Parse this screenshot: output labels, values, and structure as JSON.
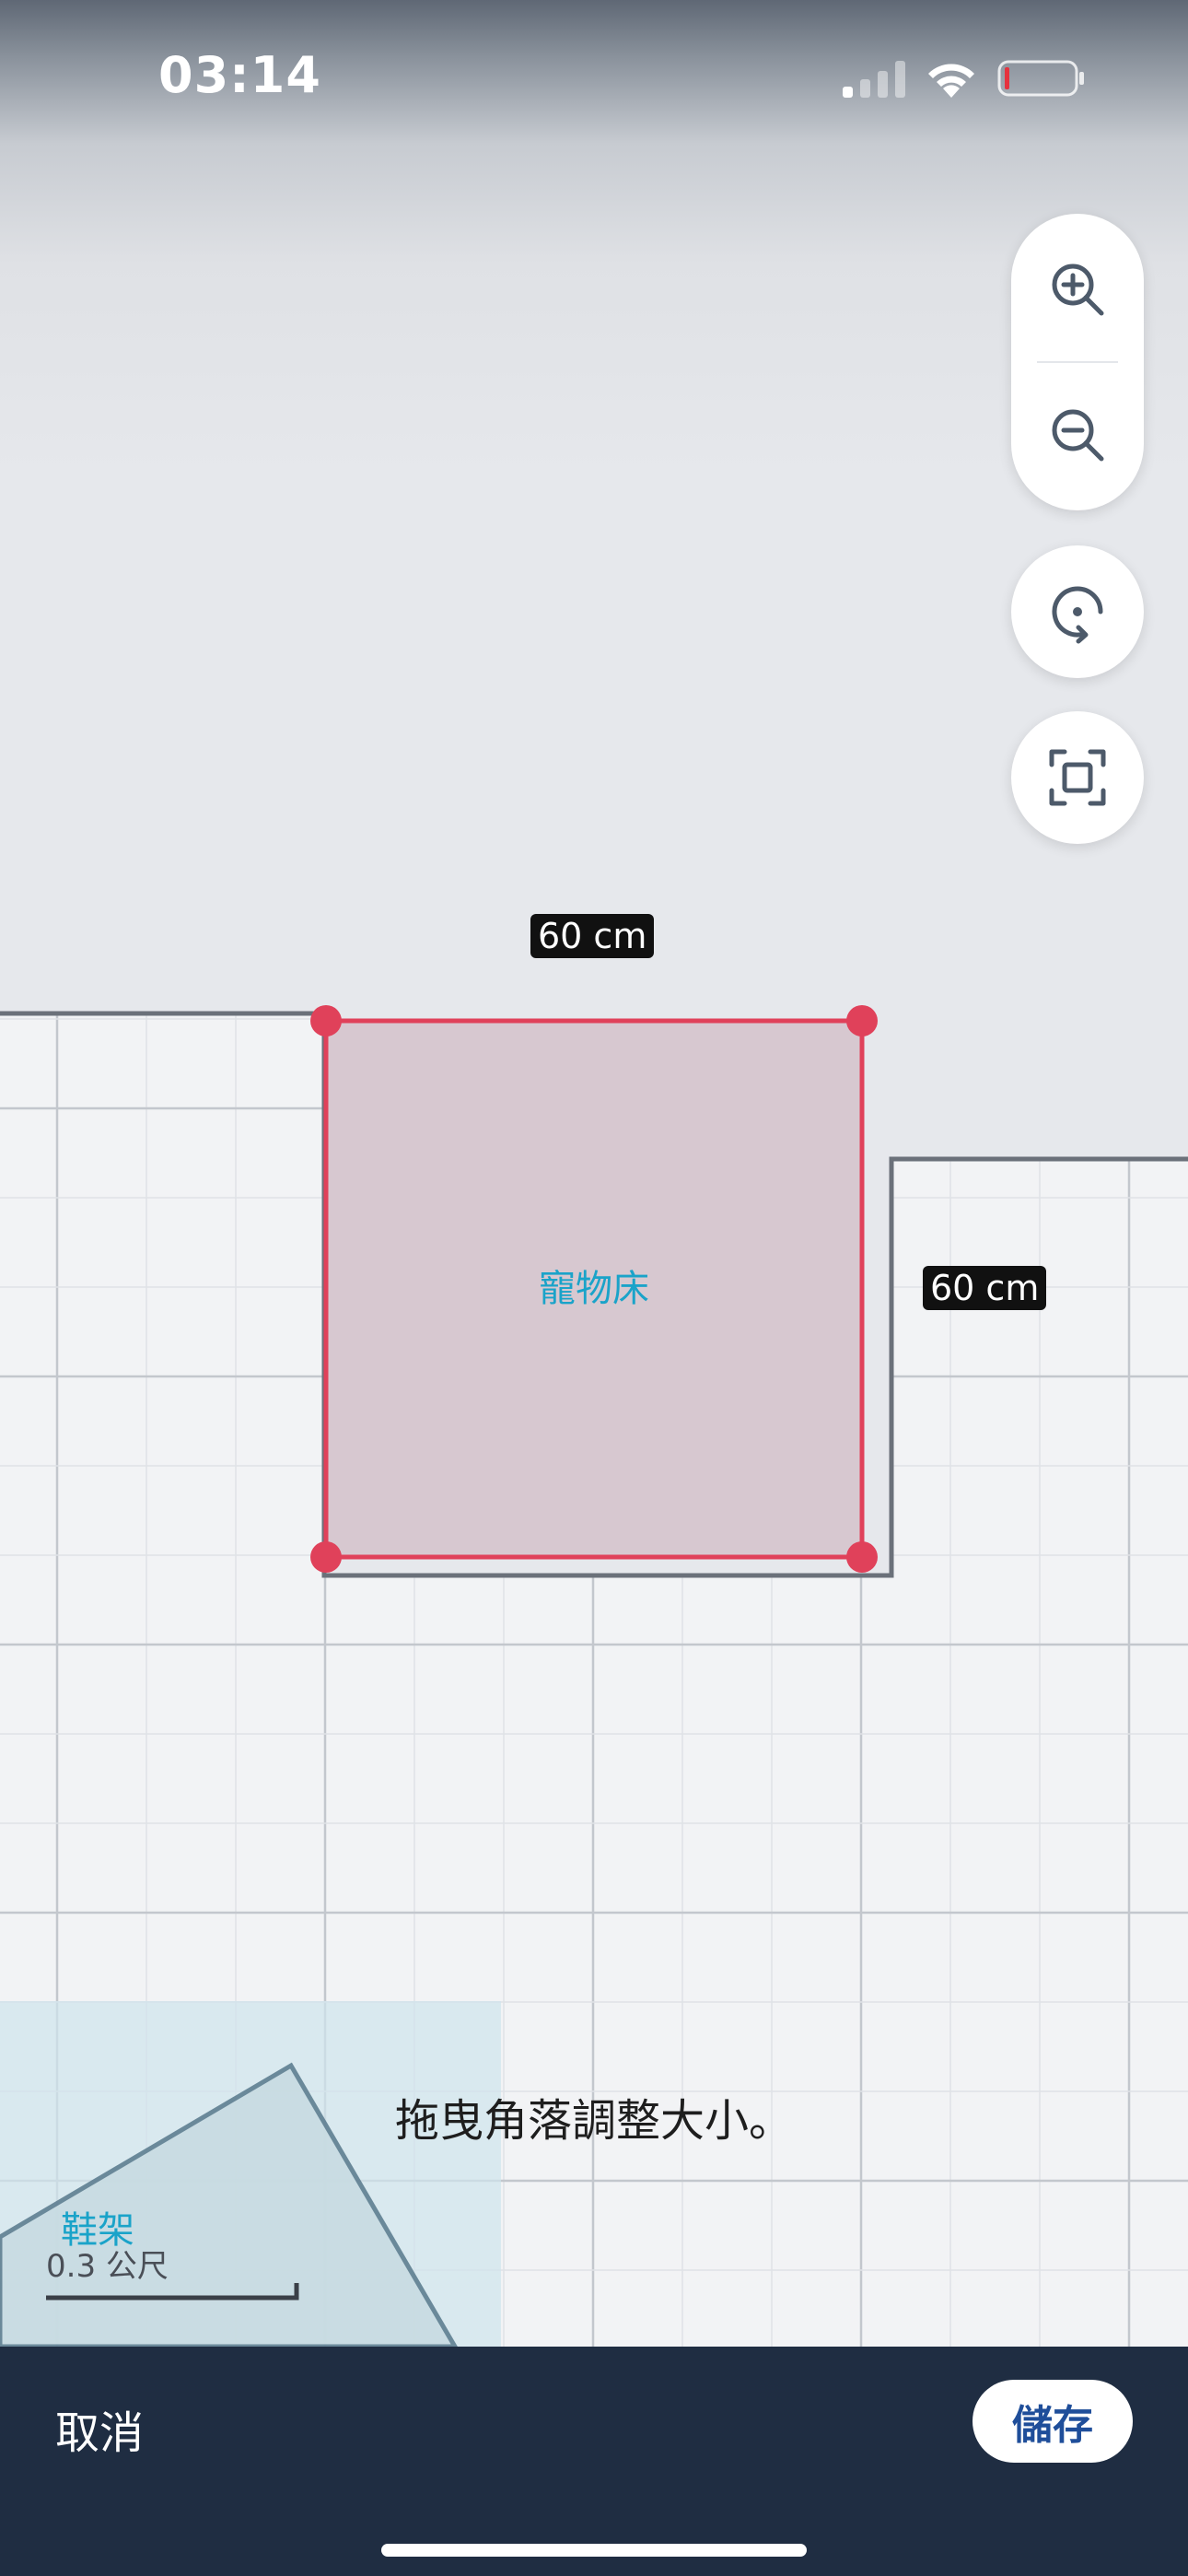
{
  "status_bar": {
    "time": "03:14"
  },
  "map_controls": {
    "zoom_in_icon": "zoom-in-icon",
    "zoom_out_icon": "zoom-out-icon",
    "rotate_icon": "rotate-icon",
    "fit_icon": "fit-screen-icon"
  },
  "selected_item": {
    "name": "寵物床",
    "width_label": "60 cm",
    "depth_label": "60 cm",
    "outline_color": "#e0415a",
    "fill_color": "#d7c8d0"
  },
  "other_items": [
    {
      "name": "鞋架"
    }
  ],
  "scale": {
    "text": "0.3 公尺"
  },
  "hint": "拖曳角落調整大小。",
  "bottom_bar": {
    "cancel_label": "取消",
    "save_label": "儲存"
  },
  "colors": {
    "accent": "#1aa3c9",
    "bottom_bar": "#1f2d42",
    "save_text": "#1f4e9a"
  }
}
